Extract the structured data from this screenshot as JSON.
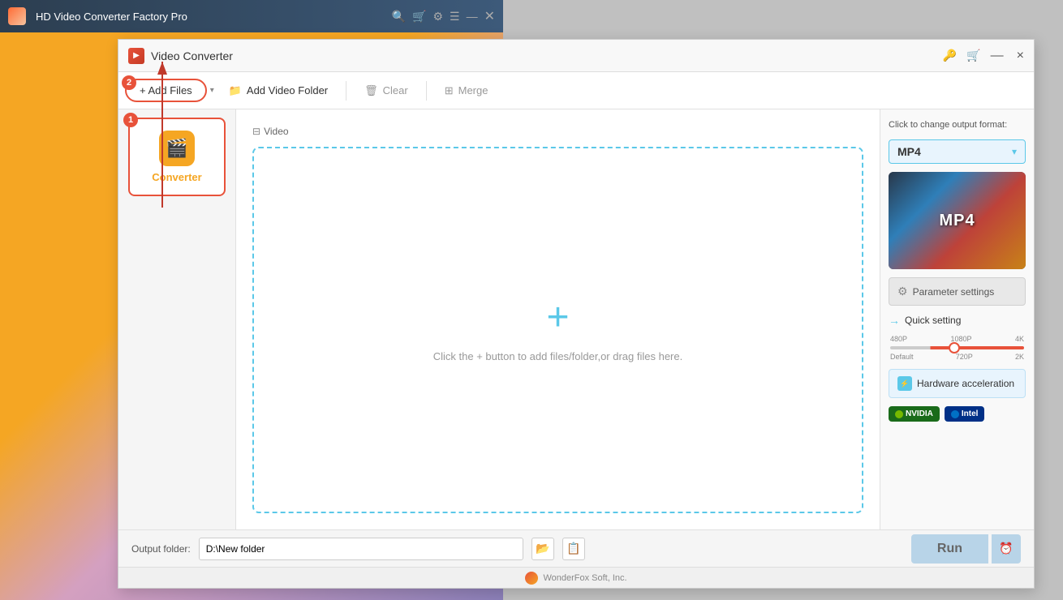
{
  "bg_app": {
    "title": "HD Video Converter Factory Pro"
  },
  "titlebar": {
    "title": "Video Converter",
    "close_icon": "×",
    "minimize_icon": "—"
  },
  "toolbar": {
    "add_files_label": "+ Add Files",
    "add_video_folder_label": "Add Video Folder",
    "clear_label": "Clear",
    "merge_label": "Merge",
    "dropdown_arrow": "▾",
    "badge_add_files": "2"
  },
  "sidebar": {
    "converter_label": "Converter",
    "badge": "1"
  },
  "drop_area": {
    "hint": "Click the + button to add files/folder,or drag files here.",
    "plus_icon": "+"
  },
  "video_tab": {
    "label": "Video"
  },
  "right_panel": {
    "format_label": "Click to change output format:",
    "format_name": "MP4",
    "format_arrow": "▾",
    "mp4_label": "MP4",
    "param_settings_label": "Parameter settings",
    "quick_setting_label": "Quick setting",
    "slider": {
      "top_labels": [
        "480P",
        "1080P",
        "4K"
      ],
      "bottom_labels": [
        "Default",
        "720P",
        "2K"
      ]
    },
    "hw_accel_label": "Hardware acceleration",
    "nvidia_label": "NVIDIA",
    "intel_label": "Intel"
  },
  "bottom_bar": {
    "output_label": "Output folder:",
    "output_value": "D:\\New folder",
    "run_label": "Run",
    "schedule_icon": "⏰",
    "folder_icon": "📁",
    "archive_icon": "📋"
  },
  "footer": {
    "logo_icon": "🦊",
    "text": "WonderFox Soft, Inc."
  }
}
